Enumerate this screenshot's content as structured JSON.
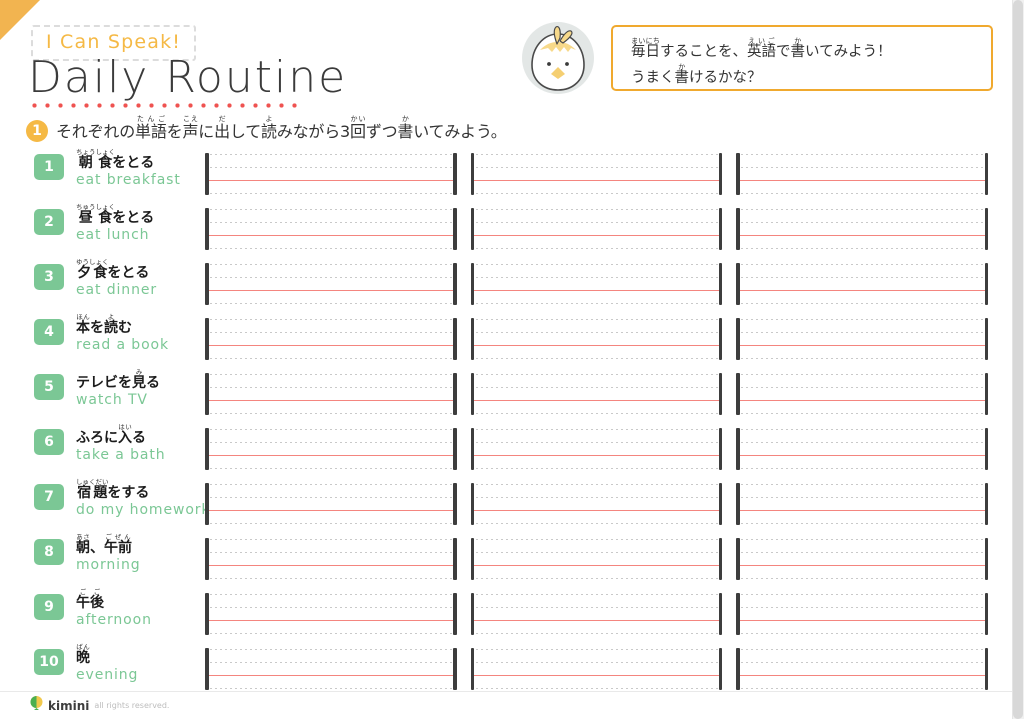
{
  "colors": {
    "accent_orange": "#f5b945",
    "corner_orange": "#f2b450",
    "badge_green": "#7bc795",
    "baseline_red": "#f4857f",
    "title_dots_red": "#ef5350",
    "guide_gray": "#c9c9c9",
    "bar_dark": "#3d3d3d"
  },
  "header": {
    "badge_label": "I Can Speak!",
    "title": "Daily Routine",
    "instruction_number": "1",
    "instruction_text": "それぞれの単語を声に出して読みながら3回ずつ書いてみよう。",
    "instruction_furigana": [
      {
        "kanji": "単語",
        "reading": "たんご"
      },
      {
        "kanji": "声",
        "reading": "こえ"
      },
      {
        "kanji": "出",
        "reading": "だ"
      },
      {
        "kanji": "読",
        "reading": "よ"
      },
      {
        "kanji": "回",
        "reading": "かい"
      },
      {
        "kanji": "書",
        "reading": "か"
      }
    ]
  },
  "mascot": {
    "icon": "chick-mascot-icon",
    "circle_color": "#e3e7e6",
    "head_color": "#ffffff",
    "crest_color": "#f7d98a",
    "beak_color": "#f5cf72"
  },
  "speech_box": {
    "line1": "毎日することを、英語で書いてみよう！",
    "line2": "うまく書けるかな？",
    "line1_furigana": [
      {
        "kanji": "毎日",
        "reading": "まいにち"
      },
      {
        "kanji": "英語",
        "reading": "えいご"
      },
      {
        "kanji": "書",
        "reading": "か"
      }
    ],
    "line2_furigana": [
      {
        "kanji": "書",
        "reading": "か"
      }
    ]
  },
  "worksheet": {
    "columns_per_row": 3,
    "rows": [
      {
        "number": "1",
        "ja": "朝食をとる",
        "ja_ruby": [
          {
            "k": "朝食",
            "r": "ちょうしょく"
          },
          {
            "k": "をとる",
            "r": ""
          }
        ],
        "en": "eat breakfast"
      },
      {
        "number": "2",
        "ja": "昼食をとる",
        "ja_ruby": [
          {
            "k": "昼食",
            "r": "ちゅうしょく"
          },
          {
            "k": "をとる",
            "r": ""
          }
        ],
        "en": "eat lunch"
      },
      {
        "number": "3",
        "ja": "夕食をとる",
        "ja_ruby": [
          {
            "k": "夕食",
            "r": "ゆうしょく"
          },
          {
            "k": "をとる",
            "r": ""
          }
        ],
        "en": "eat dinner"
      },
      {
        "number": "4",
        "ja": "本を読む",
        "ja_ruby": [
          {
            "k": "本",
            "r": "ほん"
          },
          {
            "k": "を",
            "r": ""
          },
          {
            "k": "読",
            "r": "よ"
          },
          {
            "k": "む",
            "r": ""
          }
        ],
        "en": "read a book"
      },
      {
        "number": "5",
        "ja": "テレビを見る",
        "ja_ruby": [
          {
            "k": "テレビを",
            "r": ""
          },
          {
            "k": "見",
            "r": "み"
          },
          {
            "k": "る",
            "r": ""
          }
        ],
        "en": "watch TV"
      },
      {
        "number": "6",
        "ja": "ふろに入る",
        "ja_ruby": [
          {
            "k": "ふろに",
            "r": ""
          },
          {
            "k": "入",
            "r": "はい"
          },
          {
            "k": "る",
            "r": ""
          }
        ],
        "en": "take a bath"
      },
      {
        "number": "7",
        "ja": "宿題をする",
        "ja_ruby": [
          {
            "k": "宿題",
            "r": "しゅくだい"
          },
          {
            "k": "をする",
            "r": ""
          }
        ],
        "en": "do my homework"
      },
      {
        "number": "8",
        "ja": "朝、午前",
        "ja_ruby": [
          {
            "k": "朝",
            "r": "あさ"
          },
          {
            "k": "、",
            "r": ""
          },
          {
            "k": "午前",
            "r": "ごぜん"
          }
        ],
        "en": "morning"
      },
      {
        "number": "9",
        "ja": "午後",
        "ja_ruby": [
          {
            "k": "午後",
            "r": "ごご"
          }
        ],
        "en": "afternoon"
      },
      {
        "number": "10",
        "ja": "晩",
        "ja_ruby": [
          {
            "k": "晩",
            "r": "ばん"
          }
        ],
        "en": "evening"
      }
    ]
  },
  "footer": {
    "brand": "kimini",
    "rights": "all rights reserved.",
    "logo_icon": "kimini-logo-icon"
  }
}
